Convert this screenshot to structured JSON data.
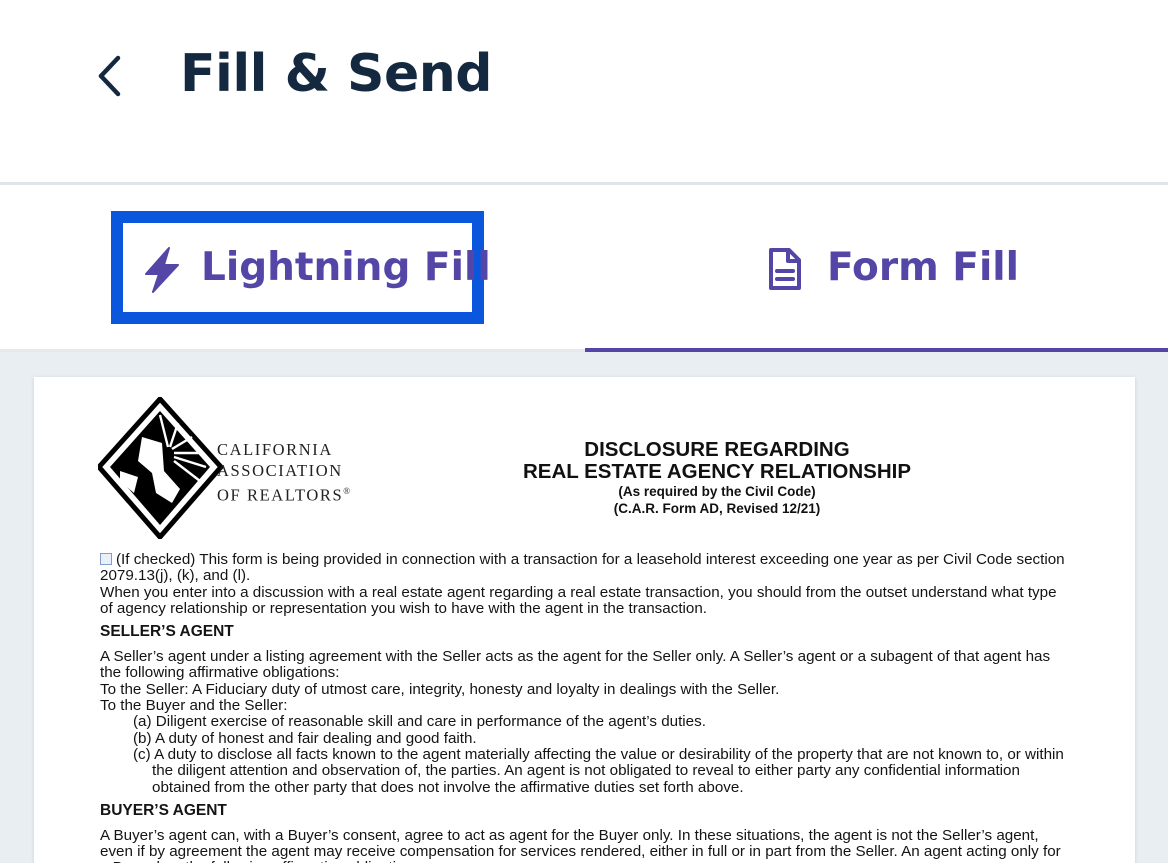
{
  "header": {
    "title": "Fill & Send",
    "back_icon": "chevron-left-icon"
  },
  "tabs": [
    {
      "label": "Lightning Fill",
      "icon": "lightning-bolt-icon",
      "selected": false,
      "focused": true
    },
    {
      "label": "Form Fill",
      "icon": "document-icon",
      "selected": true,
      "focused": false
    }
  ],
  "colors": {
    "title": "#142840",
    "tab_text": "#5446a6",
    "focus_ring": "#0a57dd",
    "tab_indicator": "#5446a6",
    "doc_background": "#e9eef3"
  },
  "document": {
    "logo_lines": [
      "CALIFORNIA",
      "ASSOCIATION",
      "OF REALTORS"
    ],
    "logo_mark": "®",
    "title_line1": "DISCLOSURE REGARDING",
    "title_line2": "REAL ESTATE AGENCY RELATIONSHIP",
    "subtitle1": "(As required by the Civil Code)",
    "subtitle2": "(C.A.R. Form AD, Revised 12/21)",
    "checkbox_text": "(If checked) This form is being provided in connection with a transaction for a leasehold interest exceeding one year as per Civil Code section 2079.13(j), (k), and (l).",
    "intro": "When you enter into a discussion with a real estate agent regarding a real estate transaction, you should from the outset understand what type of agency relationship or representation you wish to have with the agent in the transaction.",
    "seller_heading": "SELLER’S AGENT",
    "seller_p1": "A Seller’s agent under a listing agreement with the Seller acts as the agent for the Seller only. A Seller’s agent or a subagent of that agent has the following affirmative obligations:",
    "seller_p2": "To the Seller: A Fiduciary duty of utmost care, integrity, honesty and loyalty in dealings with the Seller.",
    "seller_p3": "To the Buyer and the Seller:",
    "seller_a": "(a) Diligent exercise of reasonable skill and care in performance of the agent’s duties.",
    "seller_b": "(b) A duty of honest and fair dealing and good faith.",
    "seller_c": "(c) A duty to disclose all facts known to the agent materially affecting the value or desirability of the property that are not known to, or within the diligent attention and observation of, the parties. An agent is not obligated to reveal to either party any confidential information obtained from the other party that does not involve the affirmative duties set forth above.",
    "buyer_heading": "BUYER’S AGENT",
    "buyer_p1": "A Buyer’s agent can, with a Buyer’s consent, agree to act as agent for the Buyer only. In these situations, the agent is not the Seller’s agent, even if by agreement the agent may receive compensation for services rendered, either in full or in part from the Seller. An agent acting only for a Buyer has the following affirmative obligations:"
  }
}
